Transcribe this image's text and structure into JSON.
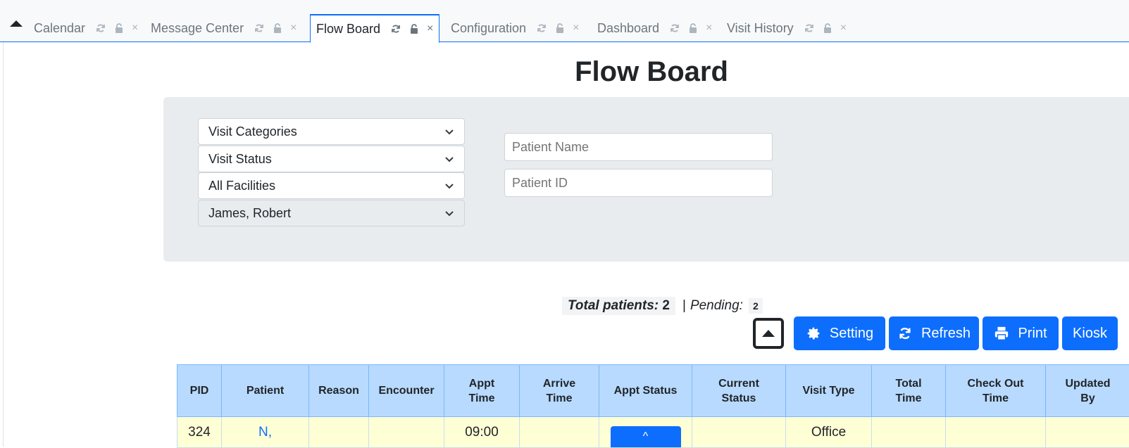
{
  "tabs": [
    {
      "label": "Calendar",
      "active": false
    },
    {
      "label": "Message Center",
      "active": false
    },
    {
      "label": "Flow Board",
      "active": true
    },
    {
      "label": "Configuration",
      "active": false
    },
    {
      "label": "Dashboard",
      "active": false
    },
    {
      "label": "Visit History",
      "active": false
    }
  ],
  "icons": {
    "tab_refresh": "refresh-icon",
    "tab_lock": "lock-icon",
    "tab_close": "close-icon",
    "tab_close_glyph": "×"
  },
  "page": {
    "title": "Flow Board"
  },
  "filters": {
    "visit_categories": "Visit Categories",
    "visit_status": "Visit Status",
    "facilities": "All Facilities",
    "provider": "James, Robert",
    "patient_name_placeholder": "Patient Name",
    "patient_id_placeholder": "Patient ID"
  },
  "summary": {
    "total_label": "Total patients:",
    "total_value": "2",
    "separator": "|",
    "pending_label": "Pending:",
    "pending_value": "2"
  },
  "toolbar": {
    "setting_label": "Setting",
    "refresh_label": "Refresh",
    "print_label": "Print",
    "kiosk_label": "Kiosk"
  },
  "table": {
    "columns": [
      [
        "PID"
      ],
      [
        "Patient"
      ],
      [
        "Reason"
      ],
      [
        "Encounter"
      ],
      [
        "Appt",
        "Time"
      ],
      [
        "Arrive",
        "Time"
      ],
      [
        "Appt Status"
      ],
      [
        "Current",
        "Status"
      ],
      [
        "Visit Type"
      ],
      [
        "Total",
        "Time"
      ],
      [
        "Check Out",
        "Time"
      ],
      [
        "Updated",
        "By"
      ]
    ],
    "rows": [
      {
        "pid": "324",
        "patient": "N,",
        "reason": "",
        "encounter": "",
        "appt_time": "09:00",
        "arrive_time": "",
        "appt_status": "^",
        "current_status": "",
        "visit_type": "Office",
        "total_time": "",
        "check_out_time": "",
        "updated_by": ""
      }
    ]
  },
  "colors": {
    "primary": "#0d6efd",
    "header_bg": "#b8daff",
    "row_bg": "#ffffd6",
    "panel_bg": "#e9ecef"
  }
}
